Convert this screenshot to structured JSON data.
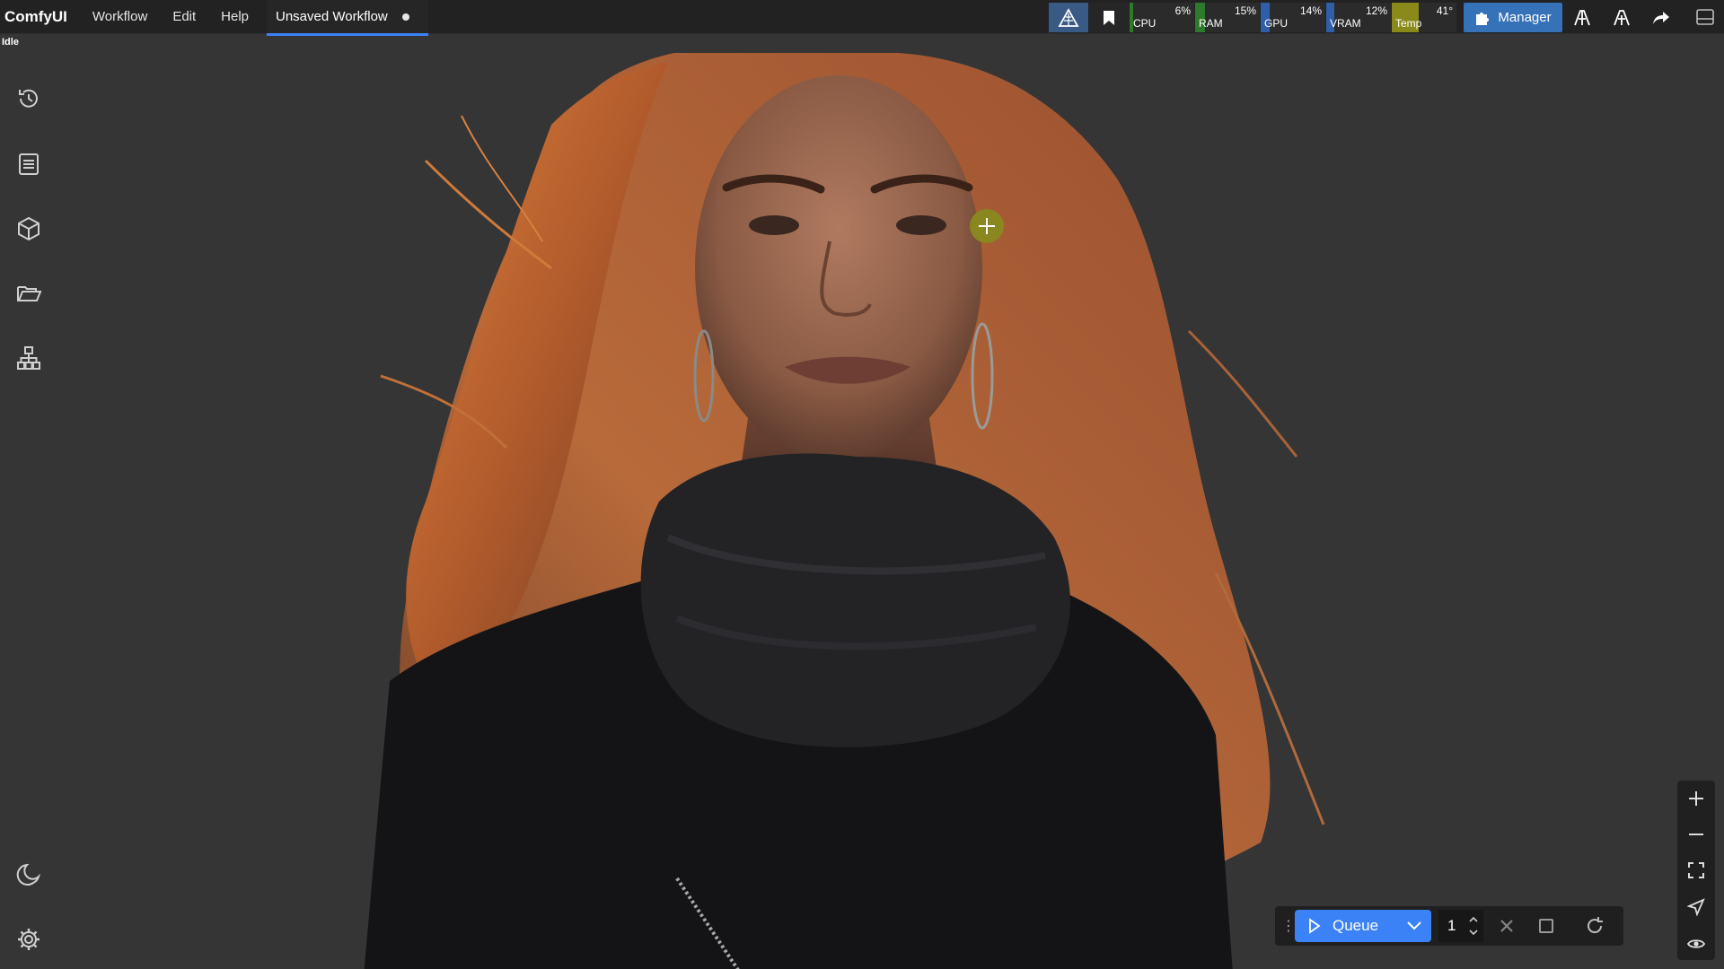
{
  "app": {
    "brand": "ComfyUI",
    "menu": [
      "Workflow",
      "Edit",
      "Help"
    ],
    "tab_title": "Unsaved Workflow",
    "status": "Idle"
  },
  "monitors": [
    {
      "label": "CPU",
      "value": "6%",
      "level": 0.06,
      "color": "#2d7a2d"
    },
    {
      "label": "RAM",
      "value": "15%",
      "level": 0.15,
      "color": "#2d7a2d"
    },
    {
      "label": "GPU",
      "value": "14%",
      "level": 0.14,
      "color": "#2f5fa8"
    },
    {
      "label": "VRAM",
      "value": "12%",
      "level": 0.12,
      "color": "#2f5fa8"
    },
    {
      "label": "Temp",
      "value": "41°",
      "level": 0.41,
      "color": "#8a8a1a"
    }
  ],
  "toolbar": {
    "manager_label": "Manager"
  },
  "sidebar": {
    "items": [
      "history-icon",
      "queue-list-icon",
      "model-library-icon",
      "workflows-folder-icon",
      "node-library-icon"
    ],
    "bottom": [
      "theme-moon-icon",
      "settings-gear-icon"
    ]
  },
  "queue": {
    "label": "Queue",
    "count": "1"
  },
  "colors": {
    "accent": "#3b82f6",
    "manager": "#3672b8",
    "background": "#353535",
    "topbar": "#222222"
  }
}
